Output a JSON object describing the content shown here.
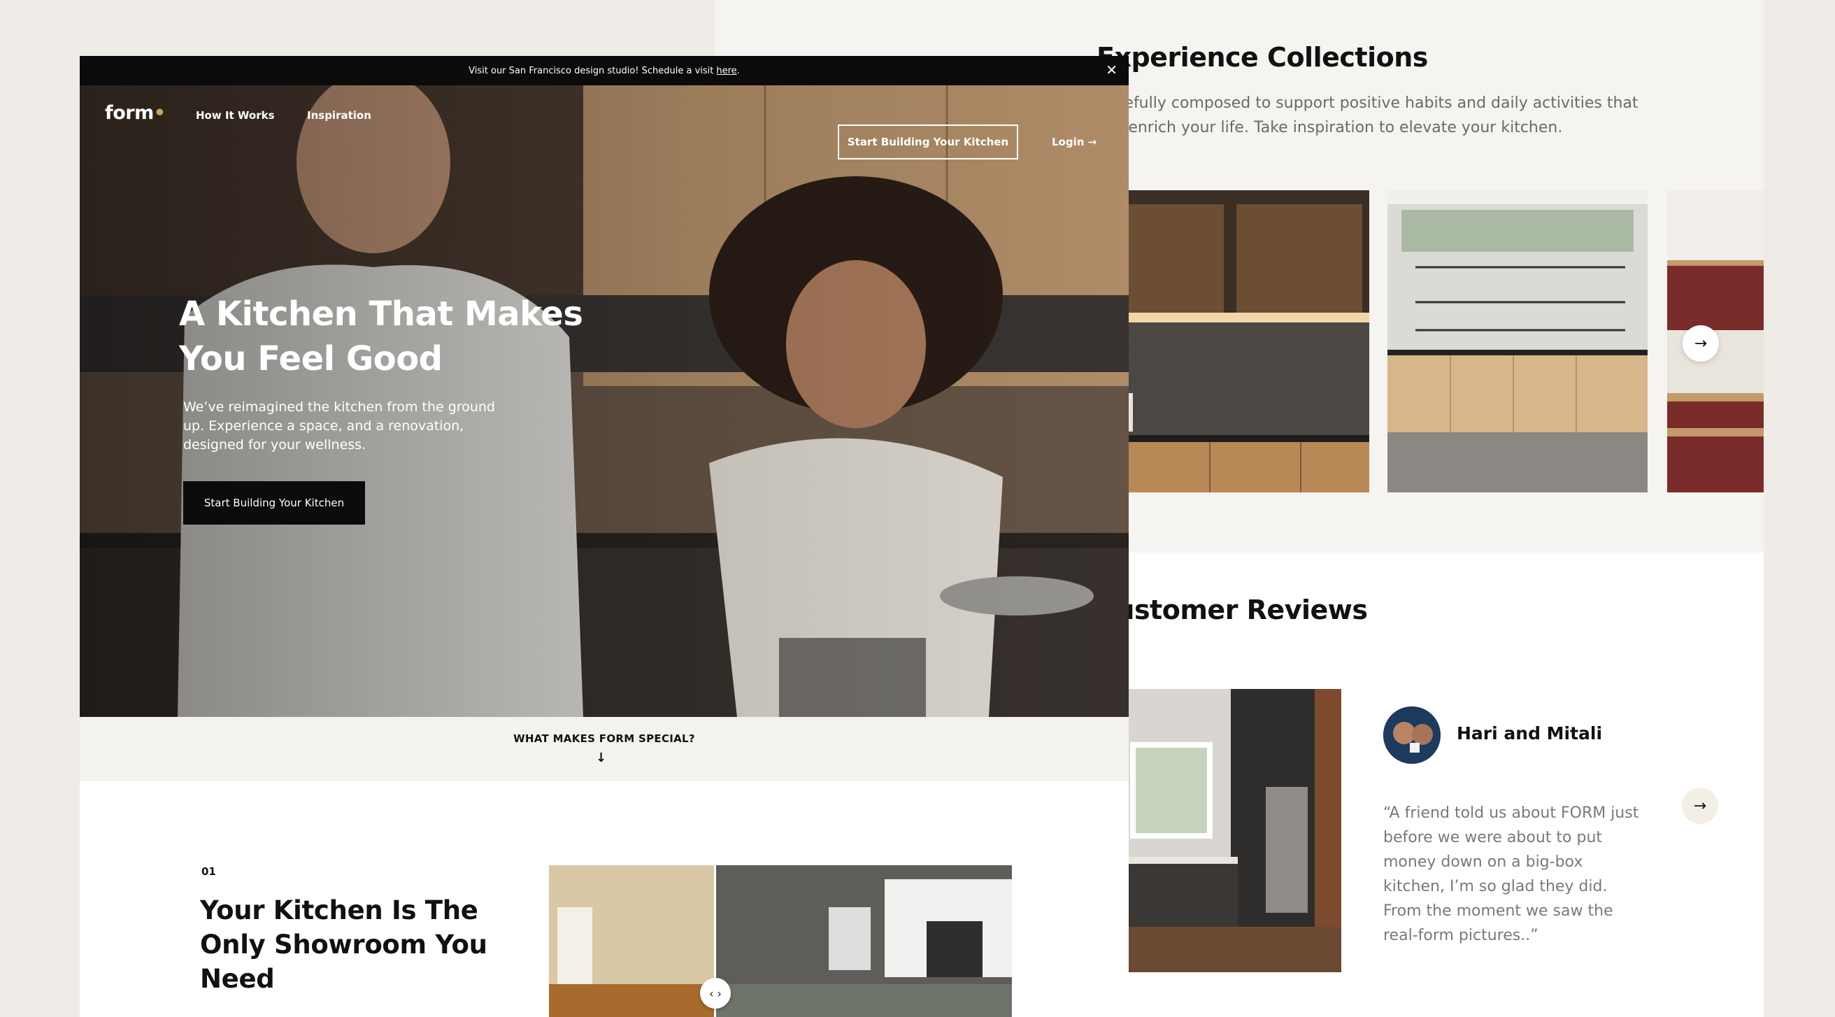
{
  "right": {
    "collections": {
      "title": "Experience Collections",
      "description": "Carefully composed to support positive habits and daily activities that will enrich your life. Take inspiration to elevate your kitchen.",
      "next_icon": "arrow-right-icon"
    },
    "reviews": {
      "title": "Customer Reviews",
      "name": "Hari and Mitali",
      "quote": "“A friend told us about FORM just before we were about to put money down on a big-box kitchen, I’m so glad they did. From the moment we saw the real-form pictures..”",
      "next_icon": "arrow-right-icon"
    }
  },
  "window": {
    "announcement": {
      "text": "Visit our San Francisco design studio! Schedule a visit",
      "link": "here",
      "suffix": ".",
      "close": "✕"
    },
    "nav": {
      "logo": "form",
      "logo_dot": "•",
      "links": [
        "How It Works",
        "Inspiration"
      ],
      "cta": "Start Building Your Kitchen",
      "login": "Login →"
    },
    "hero": {
      "title": "A Kitchen That Makes You Feel Good",
      "description": "We’ve reimagined the kitchen from the ground up. Experience a space, and a renovation, designed for your wellness.",
      "button": "Start Building Your Kitchen"
    },
    "special": {
      "label": "WHAT MAKES FORM SPECIAL?",
      "arrow": "↓"
    },
    "section1": {
      "number": "01",
      "title": "Your Kitchen Is The Only Showroom You Need",
      "compare_handle": "‹ ›"
    }
  },
  "colors": {
    "accent_gold": "#c9a35c",
    "cabinet_red": "#7a2c2a",
    "wood": "#b88957",
    "black": "#0b0b0b"
  }
}
